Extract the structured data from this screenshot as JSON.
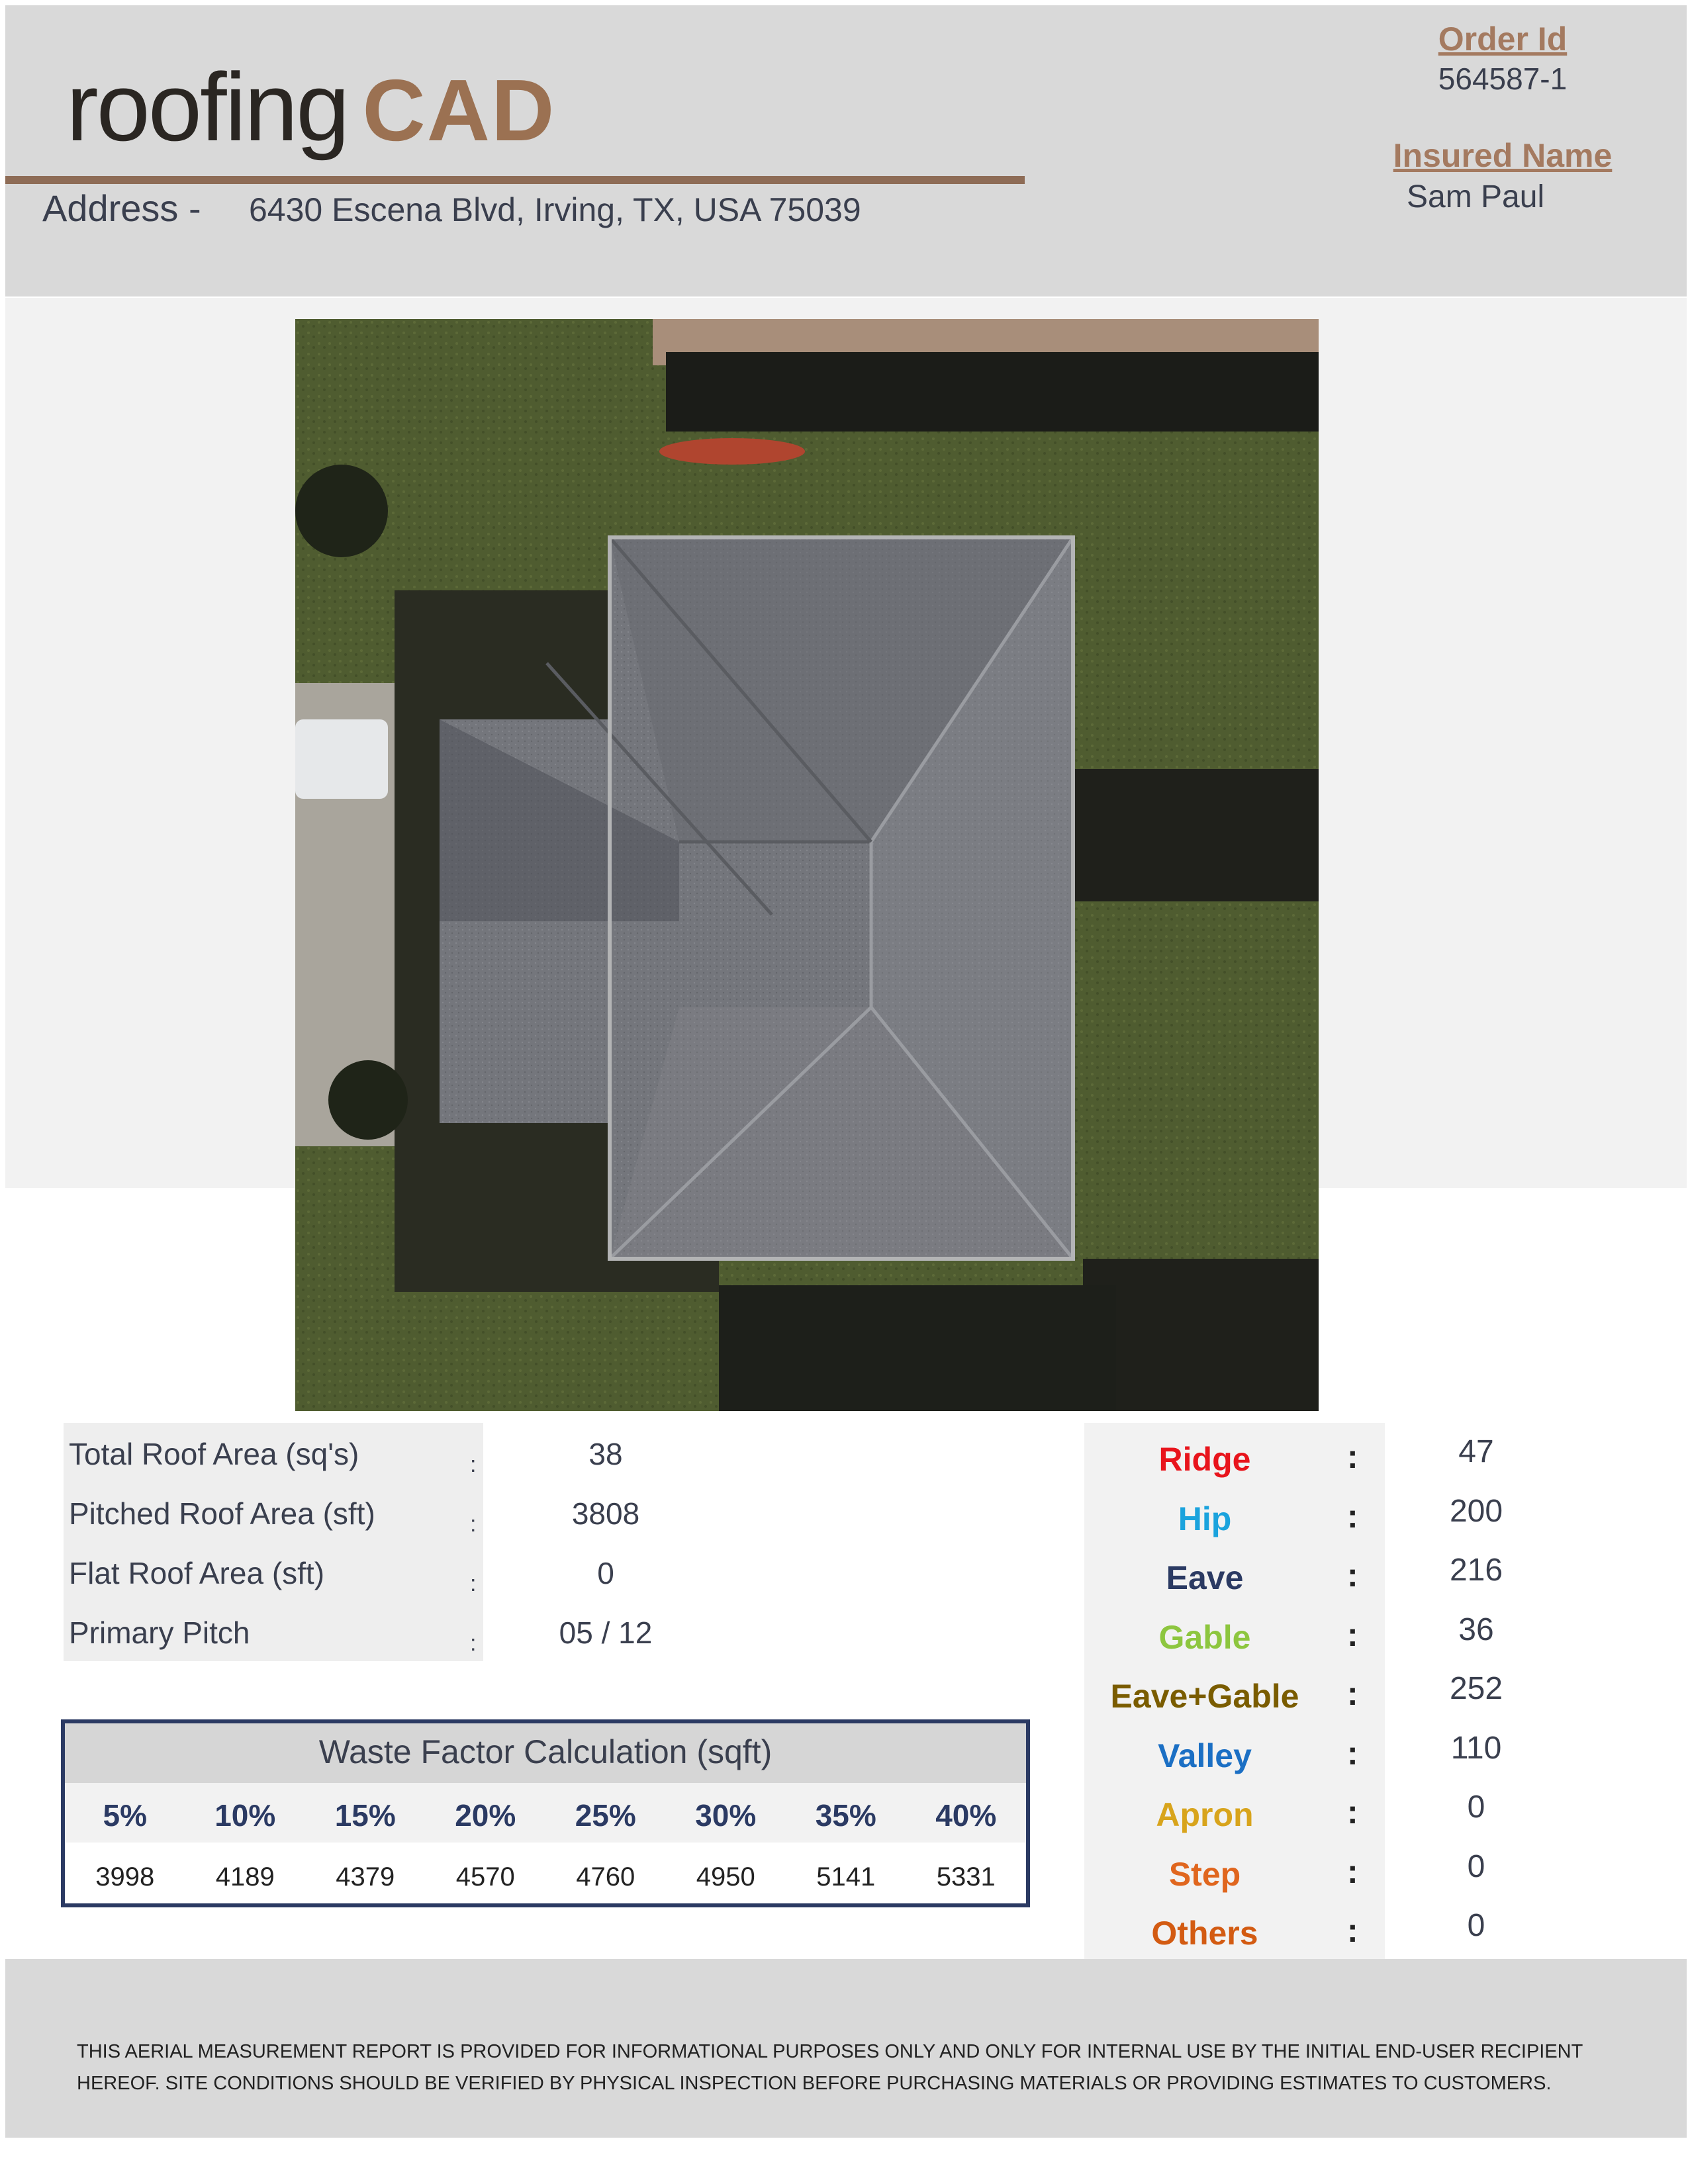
{
  "header": {
    "logo_part1": "roofing",
    "logo_part2": "CAD",
    "address_label": "Address -",
    "address_value": "6430 Escena Blvd, Irving, TX, USA 75039",
    "order_label": "Order Id",
    "order_value": "564587-1",
    "insured_label": "Insured Name",
    "insured_value": "Sam Paul"
  },
  "stats": [
    {
      "label": "Total Roof Area (sq's)",
      "value": "38"
    },
    {
      "label": "Pitched Roof Area (sft)",
      "value": "3808"
    },
    {
      "label": "Flat Roof Area (sft)",
      "value": "0"
    },
    {
      "label": "Primary Pitch",
      "value": "05 / 12"
    }
  ],
  "waste": {
    "title": "Waste Factor Calculation (sqft)",
    "percents": [
      "5%",
      "10%",
      "15%",
      "20%",
      "25%",
      "30%",
      "35%",
      "40%"
    ],
    "values": [
      "3998",
      "4189",
      "4379",
      "4570",
      "4760",
      "4950",
      "5141",
      "5331"
    ]
  },
  "lines": [
    {
      "label": "Ridge",
      "value": "47",
      "color": "#e8141c"
    },
    {
      "label": "Hip",
      "value": "200",
      "color": "#1ba3dd"
    },
    {
      "label": "Eave",
      "value": "216",
      "color": "#2b3a63"
    },
    {
      "label": "Gable",
      "value": "36",
      "color": "#8dc63f"
    },
    {
      "label": "Eave+Gable",
      "value": "252",
      "color": "#7a5c00"
    },
    {
      "label": "Valley",
      "value": "110",
      "color": "#1b6fc4"
    },
    {
      "label": "Apron",
      "value": "0",
      "color": "#d8a41c"
    },
    {
      "label": "Step",
      "value": "0",
      "color": "#e0661e"
    },
    {
      "label": "Others",
      "value": "0",
      "color": "#d35b12"
    }
  ],
  "colon": ":",
  "disclaimer_line1": "THIS AERIAL MEASUREMENT REPORT IS PROVIDED FOR INFORMATIONAL PURPOSES ONLY AND ONLY FOR INTERNAL USE BY THE INITIAL END-USER RECIPIENT",
  "disclaimer_line2": "HEREOF. SITE CONDITIONS SHOULD BE VERIFIED BY PHYSICAL INSPECTION BEFORE PURCHASING MATERIALS OR PROVIDING ESTIMATES TO CUSTOMERS."
}
